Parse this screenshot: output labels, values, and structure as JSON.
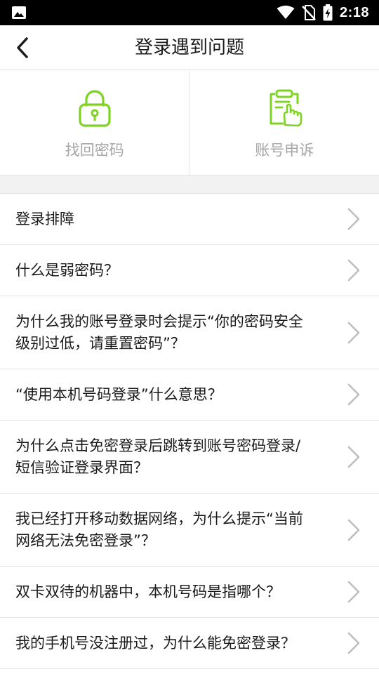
{
  "status_bar": {
    "time": "2:18",
    "icons": [
      "gallery-icon",
      "wifi-icon",
      "no-sim-icon",
      "battery-charging-icon"
    ]
  },
  "app_bar": {
    "title": "登录遇到问题",
    "back_icon": "chevron-left-icon"
  },
  "quick_actions": [
    {
      "label": "找回密码",
      "icon": "padlock-icon"
    },
    {
      "label": "账号申诉",
      "icon": "clipboard-hand-icon"
    }
  ],
  "colors": {
    "accent_green": "#7ED321",
    "label_gray": "#A6A6A6",
    "divider": "#E4E4E4",
    "band": "#F2F2F2",
    "chevron": "#BDBDBD"
  },
  "faq": {
    "items": [
      {
        "lines": [
          "登录排障"
        ]
      },
      {
        "lines": [
          "什么是弱密码？"
        ]
      },
      {
        "lines": [
          "为什么我的账号登录时会提示“你的密码安全",
          "级别过低，请重置密码”？"
        ]
      },
      {
        "lines": [
          "“使用本机号码登录”什么意思？"
        ]
      },
      {
        "lines": [
          "为什么点击免密登录后跳转到账号密码登录/",
          "短信验证登录界面？"
        ]
      },
      {
        "lines": [
          "我已经打开移动数据网络，为什么提示“当前",
          "网络无法免密登录”？"
        ]
      },
      {
        "lines": [
          "双卡双待的机器中，本机号码是指哪个？"
        ]
      },
      {
        "lines": [
          "我的手机号没注册过，为什么能免密登录？"
        ]
      }
    ]
  }
}
